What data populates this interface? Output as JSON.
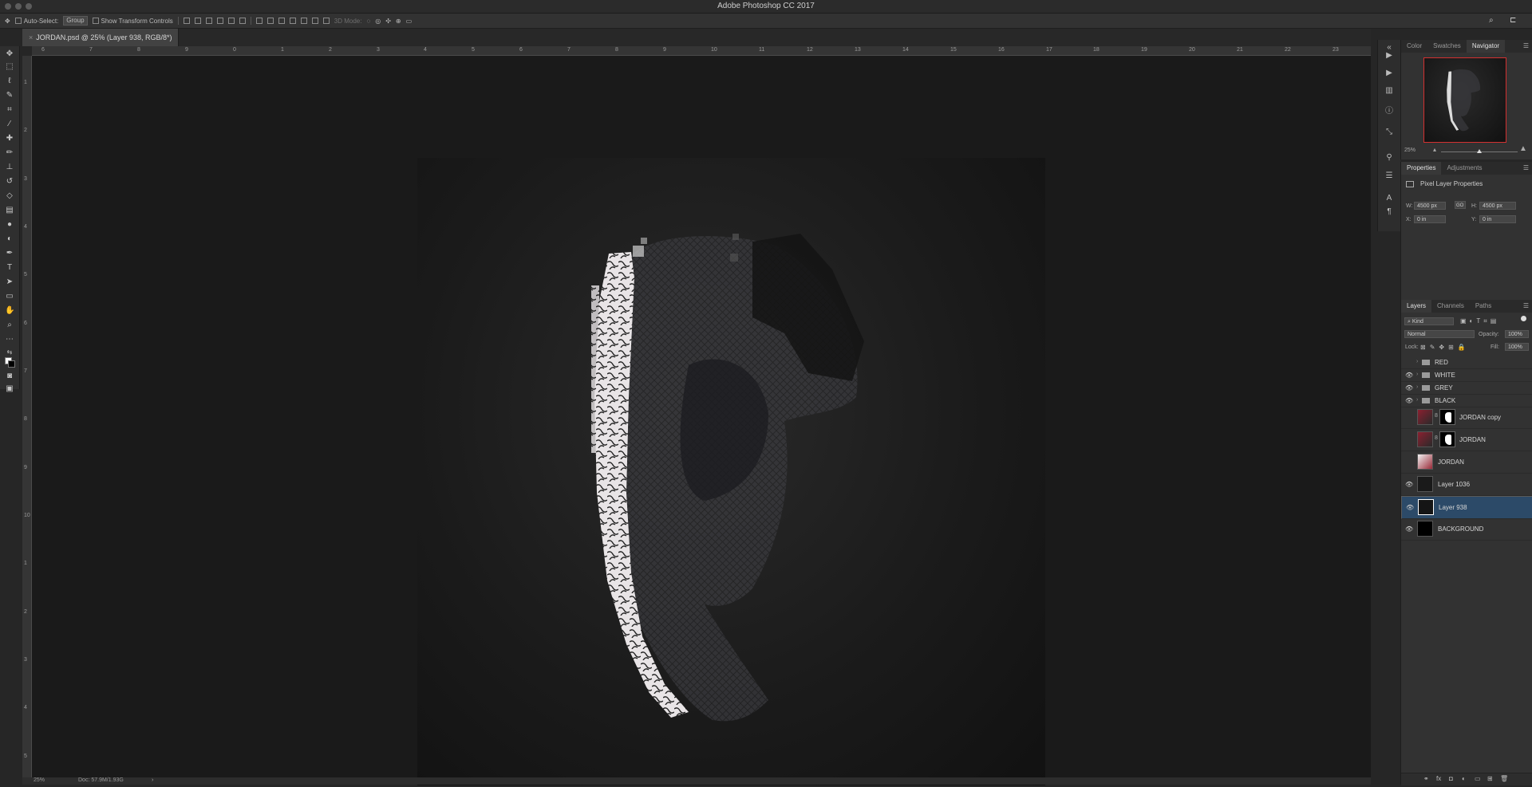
{
  "app": {
    "title": "Adobe Photoshop CC 2017"
  },
  "options_bar": {
    "auto_select_label": "Auto-Select:",
    "auto_select_value": "Group",
    "show_transform_label": "Show Transform Controls",
    "mode_3d_label": "3D Mode:"
  },
  "document": {
    "tab_label": "JORDAN.psd @ 25% (Layer 938, RGB/8*)",
    "close_glyph": "×"
  },
  "rulers": {
    "h_ticks": [
      "6",
      "7",
      "8",
      "9",
      "0",
      "1",
      "2",
      "3",
      "4",
      "5",
      "6",
      "7",
      "8",
      "9",
      "10",
      "11",
      "12",
      "13",
      "14",
      "15",
      "16",
      "17",
      "18",
      "19",
      "20",
      "21",
      "22",
      "23"
    ],
    "v_ticks": [
      "1",
      "2",
      "3",
      "4",
      "5",
      "6",
      "7",
      "8",
      "9",
      "10",
      "1",
      "2",
      "3",
      "4",
      "5"
    ]
  },
  "status": {
    "zoom": "25%",
    "doc_info": "Doc: 57.9M/1.93G"
  },
  "navigator": {
    "tabs": [
      "Color",
      "Swatches",
      "Navigator"
    ],
    "active_tab": "Navigator",
    "zoom": "25%",
    "zoom_fraction": 0.5
  },
  "properties": {
    "tabs": [
      "Properties",
      "Adjustments"
    ],
    "heading": "Pixel Layer Properties",
    "w_label": "W:",
    "w_value": "4500 px",
    "link_label": "GO",
    "h_label": "H:",
    "h_value": "4500 px",
    "x_label": "X:",
    "x_value": "0 in",
    "y_label": "Y:",
    "y_value": "0 in"
  },
  "layers_panel": {
    "tabs": [
      "Layers",
      "Channels",
      "Paths"
    ],
    "filter_label": "Kind",
    "blend_mode": "Normal",
    "opacity_label": "Opacity:",
    "opacity_value": "100%",
    "lock_label": "Lock:",
    "fill_label": "Fill:",
    "fill_value": "100%",
    "layers": [
      {
        "name": "RED",
        "type": "group",
        "visible": false
      },
      {
        "name": "WHITE",
        "type": "group",
        "visible": true
      },
      {
        "name": "GREY",
        "type": "group",
        "visible": true
      },
      {
        "name": "BLACK",
        "type": "group",
        "visible": true
      },
      {
        "name": "JORDAN copy",
        "type": "masked",
        "visible": false
      },
      {
        "name": "JORDAN",
        "type": "masked",
        "visible": false
      },
      {
        "name": "JORDAN",
        "type": "pixel",
        "visible": false
      },
      {
        "name": "Layer 1036",
        "type": "pixel",
        "visible": true
      },
      {
        "name": "Layer 938",
        "type": "pixel",
        "visible": true,
        "selected": true
      },
      {
        "name": "BACKGROUND",
        "type": "pixel",
        "visible": true
      }
    ]
  },
  "colors": {
    "selected_layer": "#2c4a68",
    "navigator_frame": "#d33030"
  },
  "icons": [
    "move-icon",
    "marquee-icon",
    "lasso-icon",
    "quick-select-icon",
    "crop-icon",
    "eyedropper-icon",
    "healing-icon",
    "brush-icon",
    "stamp-icon",
    "history-brush-icon",
    "eraser-icon",
    "gradient-icon",
    "blur-icon",
    "dodge-icon",
    "pen-icon",
    "type-icon",
    "path-select-icon",
    "shape-icon",
    "hand-icon",
    "zoom-icon",
    "more-icon",
    "swap-colors-icon",
    "color-swatches-icon",
    "quick-mask-icon",
    "screen-mode-icon"
  ]
}
